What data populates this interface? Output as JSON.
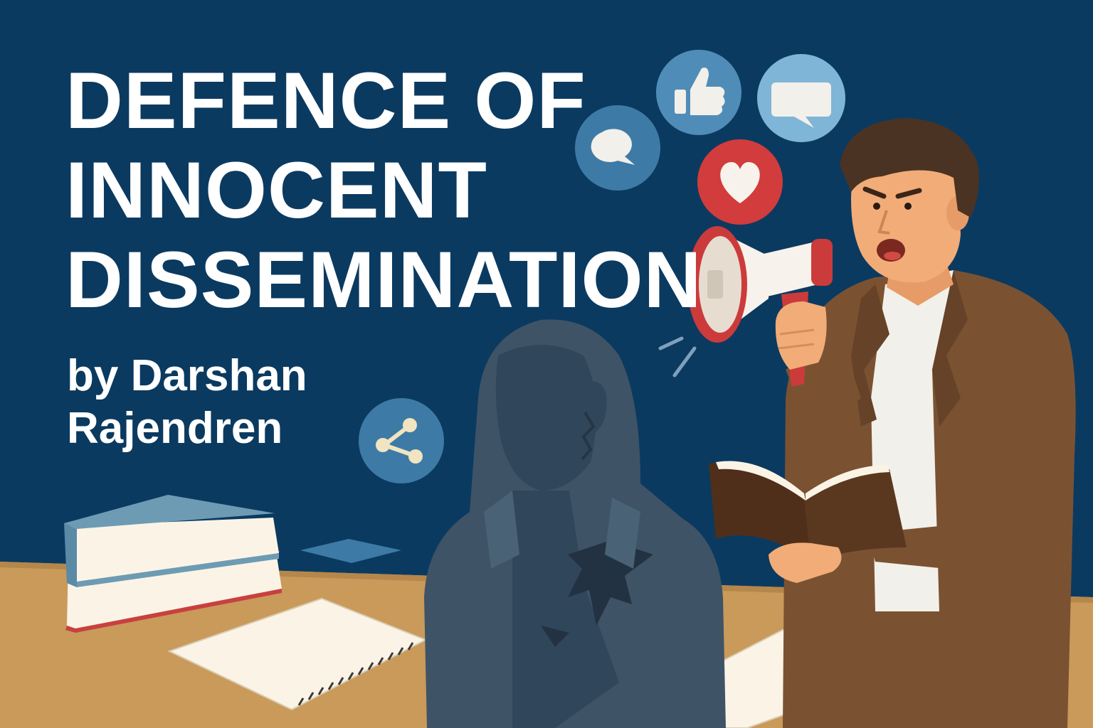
{
  "title": {
    "line1": "DEFENCE OF",
    "line2": "INNOCENT",
    "line3": "DISSEMINATION"
  },
  "byline": {
    "line1": "by Darshan",
    "line2": "Rajendren"
  },
  "colors": {
    "background": "#0b3a60",
    "title_text": "#ffffff",
    "desk": "#c99a5a",
    "jacket": "#7a5232",
    "shirt": "#f2f0ea",
    "skin": "#f2ac78",
    "hair": "#4a3322",
    "megaphone_red": "#cc3b3b",
    "megaphone_white": "#f7f3ec",
    "silhouette": "#3e5366",
    "icon_blue": "#3d7ba6",
    "icon_light_blue": "#7fb5d6",
    "heart_red": "#d23c3c",
    "book_blue": "#6e9bb4",
    "book_red": "#c84040",
    "paper": "#fbf4e6"
  },
  "icons": [
    "speech-bubble-icon",
    "thumbs-up-icon",
    "chat-icon",
    "heart-icon",
    "share-icon"
  ]
}
